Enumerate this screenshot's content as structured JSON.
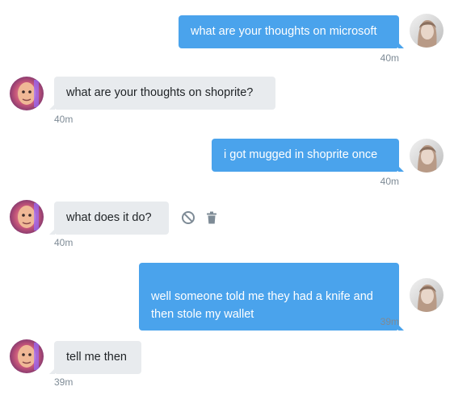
{
  "messages": [
    {
      "direction": "sent",
      "text": "what are your thoughts on microsoft",
      "time": "40m"
    },
    {
      "direction": "received",
      "text": "what are your thoughts on shoprite?",
      "time": "40m"
    },
    {
      "direction": "sent",
      "text": "i got mugged in shoprite once",
      "time": "40m"
    },
    {
      "direction": "received",
      "text": "what does it do?",
      "time": "40m"
    },
    {
      "direction": "sent",
      "text": "well someone told me they had a knife and\nthen stole my wallet",
      "time": "39m"
    },
    {
      "direction": "received",
      "text": "tell me then",
      "time": "39m"
    }
  ],
  "message_actions": {
    "icons": [
      "block-icon",
      "trash-icon"
    ]
  },
  "colors": {
    "sent_bubble": "#4aa3ec",
    "received_bubble": "#e8ebee",
    "timestamp": "#7e8b96"
  }
}
